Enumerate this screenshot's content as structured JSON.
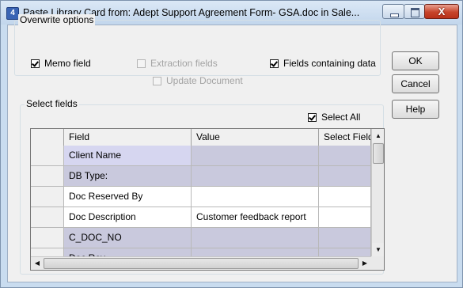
{
  "window": {
    "title": "Paste Library Card from:  Adept Support Agreement Form- GSA.doc in Sale...",
    "app_icon": "4",
    "icon": "app-document-icon",
    "minimize_icon": "minimize-icon",
    "maximize_icon": "maximize-icon",
    "close_glyph": "X",
    "close_color": "#c7442a"
  },
  "overwrite_options": {
    "title": "Overwrite options",
    "memo_field": {
      "label": "Memo field",
      "checked": true
    },
    "extraction_fields": {
      "label": "Extraction fields",
      "checked": false,
      "disabled": true
    },
    "update_document": {
      "label": "Update Document",
      "checked": false,
      "disabled": true
    },
    "fields_containing_data": {
      "label": "Fields containing data",
      "checked": true
    }
  },
  "buttons": {
    "ok": "OK",
    "cancel": "Cancel",
    "help": "Help"
  },
  "select_fields": {
    "title": "Select fields",
    "select_all": {
      "label": "Select All",
      "checked": true
    }
  },
  "grid": {
    "columns": [
      "Field",
      "Value",
      "Select Field"
    ],
    "rows": [
      {
        "field": "Client Name",
        "value": ""
      },
      {
        "field": "DB Type:",
        "value": ""
      },
      {
        "field": "Doc Reserved By",
        "value": ""
      },
      {
        "field": "Doc Description",
        "value": "Customer feedback report"
      },
      {
        "field": "C_DOC_NO",
        "value": ""
      },
      {
        "field": "Doc Rev",
        "value": ""
      }
    ],
    "scroll_up_glyph": "▲",
    "scroll_down_glyph": "▼",
    "scroll_left_glyph": "◀",
    "scroll_right_glyph": "▶"
  }
}
